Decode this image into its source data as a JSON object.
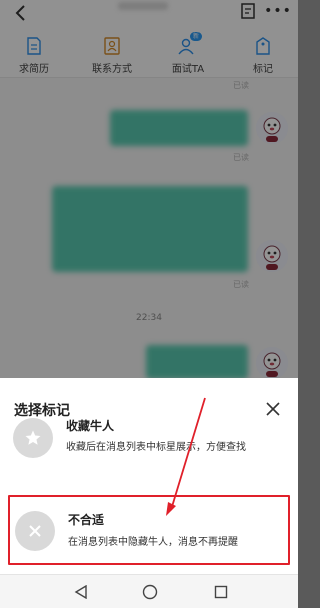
{
  "actions": [
    {
      "label": "求简历",
      "icon": "resume-icon"
    },
    {
      "label": "联系方式",
      "icon": "contact-card-icon"
    },
    {
      "label": "面试TA",
      "icon": "interview-icon",
      "badge": "新"
    },
    {
      "label": "标记",
      "icon": "tag-icon"
    }
  ],
  "chat": {
    "read_label": "已读",
    "time": "22:34",
    "bubble_color": "#59c9b0"
  },
  "sheet": {
    "title": "选择标记",
    "options": [
      {
        "title": "收藏牛人",
        "desc": "收藏后在消息列表中标星展示，方便查找",
        "icon": "star-icon"
      },
      {
        "title": "不合适",
        "desc": "在消息列表中隐藏牛人，消息不再提醒",
        "icon": "close-x-icon",
        "highlighted": true
      }
    ]
  },
  "colors": {
    "highlight": "#e0202a",
    "accent": "#2b9af3"
  }
}
